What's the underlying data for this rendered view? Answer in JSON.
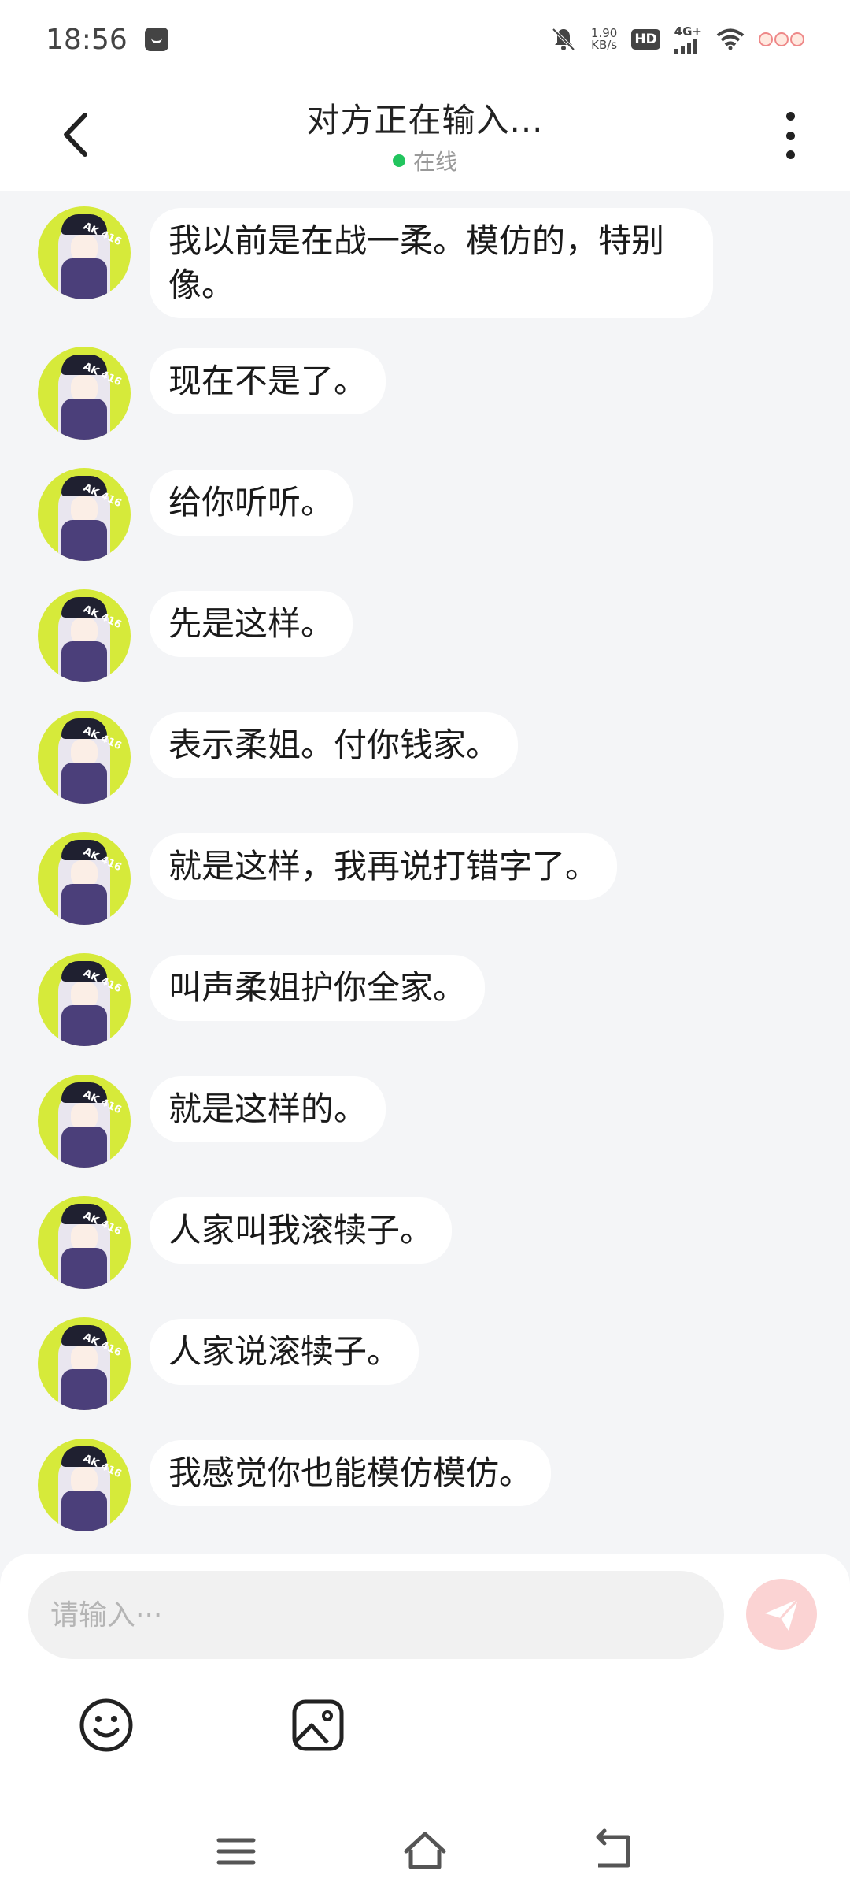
{
  "status_bar": {
    "time": "18:56",
    "net_speed_value": "1.90",
    "net_speed_unit": "KB/s",
    "hd_label": "HD",
    "signal_label": "4G+"
  },
  "header": {
    "title": "对方正在输入...",
    "status": "在线",
    "status_color": "#22c55e"
  },
  "avatar_tag": "AK 416",
  "messages": [
    {
      "text": "我以前是在战一柔。模仿的，特别像。"
    },
    {
      "text": "现在不是了。"
    },
    {
      "text": "给你听听。"
    },
    {
      "text": "先是这样。"
    },
    {
      "text": "表示柔姐。付你钱家。"
    },
    {
      "text": "就是这样，我再说打错字了。"
    },
    {
      "text": "叫声柔姐护你全家。"
    },
    {
      "text": "就是这样的。"
    },
    {
      "text": "人家叫我滚犊子。"
    },
    {
      "text": "人家说滚犊子。"
    },
    {
      "text": "我感觉你也能模仿模仿。"
    }
  ],
  "input": {
    "placeholder": "请输入···",
    "value": ""
  },
  "icons": {
    "back": "chevron-left-icon",
    "more": "more-vertical-icon",
    "send": "send-icon",
    "emoji": "emoji-icon",
    "image": "image-icon",
    "nav_menu": "menu-icon",
    "nav_home": "home-icon",
    "nav_back": "back-icon"
  },
  "colors": {
    "background": "#f4f5f7",
    "bubble": "#ffffff",
    "avatar_bg": "#d6ea3a",
    "send_button": "#fbd3d3"
  }
}
